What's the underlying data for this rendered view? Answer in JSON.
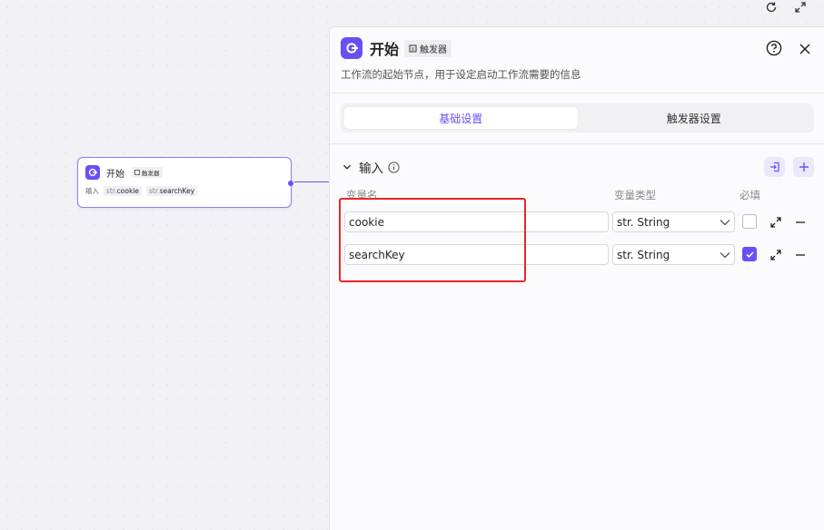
{
  "canvas": {
    "tools": [
      {
        "icon": "refresh-icon"
      },
      {
        "icon": "expand-icon"
      }
    ]
  },
  "node": {
    "title": "开始",
    "badge": "触发器",
    "input_label": "输入",
    "params": [
      {
        "type_prefix": "str.",
        "name": "cookie"
      },
      {
        "type_prefix": "str.",
        "name": "searchKey"
      }
    ]
  },
  "panel": {
    "title": "开始",
    "badge": "触发器",
    "description": "工作流的起始节点，用于设定启动工作流需要的信息",
    "tabs": [
      {
        "label": "基础设置",
        "active": true
      },
      {
        "label": "触发器设置",
        "active": false
      }
    ],
    "section": {
      "title": "输入",
      "columns": {
        "name": "变量名",
        "type": "变量类型",
        "required": "必填"
      },
      "rows": [
        {
          "name": "cookie",
          "type": "str. String",
          "required": false
        },
        {
          "name": "searchKey",
          "type": "str. String",
          "required": true
        }
      ]
    }
  },
  "colors": {
    "accent": "#6b4ef5",
    "highlight": "#e8262a"
  }
}
